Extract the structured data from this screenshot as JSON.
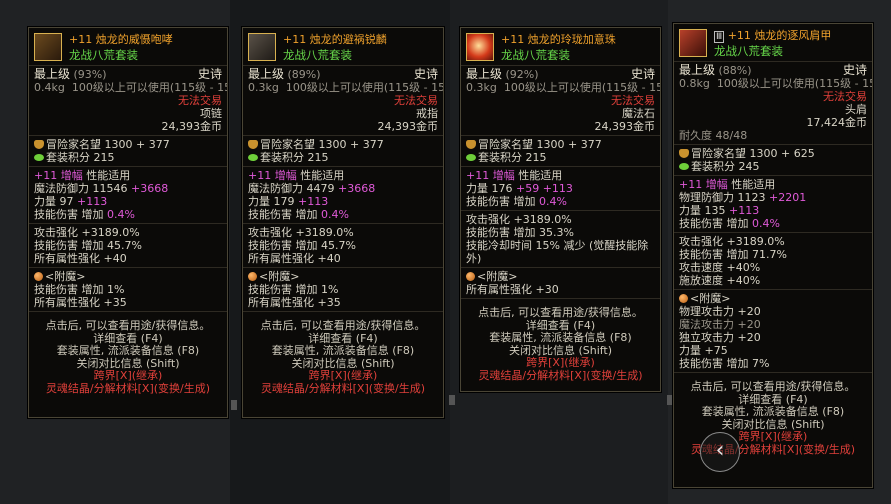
{
  "tooltips": [
    {
      "enhance": "+11",
      "name": "烛龙的威慑咆哮",
      "set": "龙战八荒套装",
      "level": "最上级",
      "level_pct": "(93%)",
      "rarity": "史诗",
      "weight": "0.4kg",
      "use": "100级以上可以使用(115级 - 15)",
      "trade": "无法交易",
      "slot": "项链",
      "price": "24,393金币",
      "fame_label": "冒险家名望",
      "fame": "1300 + 377",
      "setpts_label": "套装积分",
      "setpts": "215",
      "amp_enh": "+11",
      "amp_word": "增幅",
      "amp_rest": "性能适用",
      "def_label": "魔法防御力",
      "def_val": "11546",
      "def_plus": "+3668",
      "str_label": "力量",
      "str_val": "97",
      "str_plus": "+113",
      "skill_label": "技能伤害",
      "skill_inc": "增加",
      "skill_pct": "0.4%",
      "line1": "攻击强化 +3189.0%",
      "line2": "技能伤害 增加 45.7%",
      "line3": "所有属性强化 +40",
      "enchant_title": "<附魔>",
      "ench1": "技能伤害  增加 1%",
      "ench2": "所有属性强化 +35",
      "foot1": "点击后, 可以查看用途/获得信息。",
      "foot2": "详细查看 (F4)",
      "foot3": "套装属性, 流派装备信息 (F8)",
      "foot4": "关闭对比信息 (Shift)",
      "foot5": "跨界[X](继承)",
      "foot6": "灵魂结晶/分解材料[X](变换/生成)"
    },
    {
      "enhance": "+11",
      "name": "烛龙的避祸锐麟",
      "set": "龙战八荒套装",
      "level": "最上级",
      "level_pct": "(89%)",
      "rarity": "史诗",
      "weight": "0.3kg",
      "use": "100级以上可以使用(115级 - 15)",
      "trade": "无法交易",
      "slot": "戒指",
      "price": "24,393金币",
      "fame_label": "冒险家名望",
      "fame": "1300 + 377",
      "setpts_label": "套装积分",
      "setpts": "215",
      "amp_enh": "+11",
      "amp_word": "增幅",
      "amp_rest": "性能适用",
      "def_label": "魔法防御力",
      "def_val": "4479",
      "def_plus": "+3668",
      "str_label": "力量",
      "str_val": "179",
      "str_plus": "+113",
      "skill_label": "技能伤害",
      "skill_inc": "增加",
      "skill_pct": "0.4%",
      "line1": "攻击强化 +3189.0%",
      "line2": "技能伤害 增加 45.7%",
      "line3": "所有属性强化 +40",
      "enchant_title": "<附魔>",
      "ench1": "技能伤害  增加 1%",
      "ench2": "所有属性强化 +35",
      "foot1": "点击后, 可以查看用途/获得信息。",
      "foot2": "详细查看 (F4)",
      "foot3": "套装属性, 流派装备信息 (F8)",
      "foot4": "关闭对比信息 (Shift)",
      "foot5": "跨界[X](继承)",
      "foot6": "灵魂结晶/分解材料[X](变换/生成)"
    },
    {
      "enhance": "+11",
      "name": "烛龙的玲珑加意珠",
      "set": "龙战八荒套装",
      "level": "最上级",
      "level_pct": "(92%)",
      "rarity": "史诗",
      "weight": "0.3kg",
      "use": "100级以上可以使用(115级 - 15)",
      "trade": "无法交易",
      "slot": "魔法石",
      "price": "24,393金币",
      "fame_label": "冒险家名望",
      "fame": "1300 + 377",
      "setpts_label": "套装积分",
      "setpts": "215",
      "amp_enh": "+11",
      "amp_word": "增幅",
      "amp_rest": "性能适用",
      "str_label": "力量",
      "str_val": "176",
      "str_plus": "+59",
      "str_plus2": "+113",
      "skill_label": "技能伤害",
      "skill_inc": "增加",
      "skill_pct": "0.4%",
      "line1": "攻击强化 +3189.0%",
      "line2": "技能伤害 增加 35.3%",
      "line3": "技能冷却时间 15% 减少 (觉醒技能除",
      "line4": "外)",
      "enchant_title": "<附魔>",
      "ench1": "所有属性强化 +30",
      "foot1": "点击后, 可以查看用途/获得信息。",
      "foot2": "详细查看 (F4)",
      "foot3": "套装属性, 流派装备信息 (F8)",
      "foot4": "关闭对比信息 (Shift)",
      "foot5": "跨界[X](继承)",
      "foot6": "灵魂结晶/分解材料[X](变换/生成)"
    },
    {
      "tag": "Ⅲ",
      "enhance": "+11",
      "name": "烛龙的逐风肩甲",
      "set": "龙战八荒套装",
      "level": "最上级",
      "level_pct": "(88%)",
      "rarity": "史诗",
      "weight": "0.8kg",
      "use": "100级以上可以使用(115级 - 15)",
      "trade": "无法交易",
      "slot": "头肩",
      "price": "17,424金币",
      "durability": "耐久度 48/48",
      "fame_label": "冒险家名望",
      "fame": "1300 + 625",
      "setpts_label": "套装积分",
      "setpts": "245",
      "amp_enh": "+11",
      "amp_word": "增幅",
      "amp_rest": "性能适用",
      "def_label": "物理防御力",
      "def_val": "1123",
      "def_plus": "+2201",
      "str_label": "力量",
      "str_val": "135",
      "str_plus": "+113",
      "skill_label": "技能伤害",
      "skill_inc": "增加",
      "skill_pct": "0.4%",
      "line1": "攻击强化 +3189.0%",
      "line2": "技能伤害 增加 71.7%",
      "line3": "攻击速度 +40%",
      "line4": "施放速度 +40%",
      "enchant_title": "<附魔>",
      "ench1": "物理攻击力 +20",
      "ench2": "魔法攻击力 +20",
      "ench3": "独立攻击力 +20",
      "ench4": "力量 +75",
      "ench5": "技能伤害 增加 7%",
      "foot1": "点击后, 可以查看用途/获得信息。",
      "foot2": "详细查看 (F4)",
      "foot3": "套装属性, 流派装备信息 (F8)",
      "foot4": "关闭对比信息 (Shift)",
      "foot5": "跨界[X](继承)",
      "foot6": "灵魂结晶/分解材料[X](变换/生成)"
    }
  ],
  "back_icon": "‹"
}
